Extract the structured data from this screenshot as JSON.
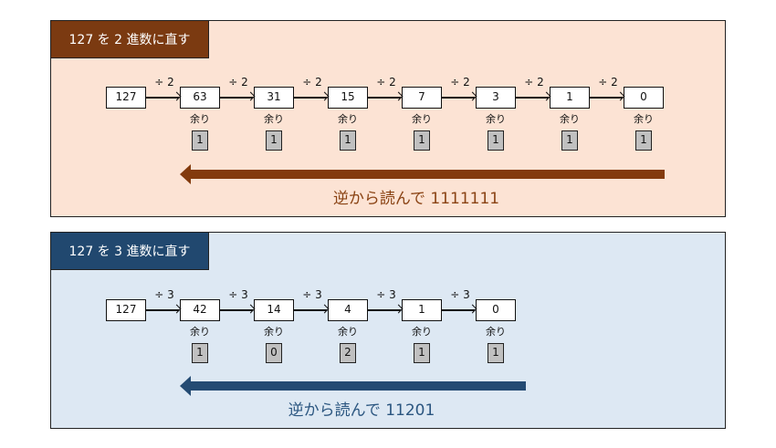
{
  "colors": {
    "brown_header": "#7b3a11",
    "brown_bg": "#fce3d4",
    "brown_arrow": "#833a0d",
    "brown_text": "#8a4314",
    "blue_header": "#21486f",
    "blue_bg": "#dde8f3",
    "blue_arrow": "#244b73",
    "blue_text": "#2b5680"
  },
  "base2": {
    "title": "127 を 2 進数に直す",
    "operator": "÷ 2",
    "quotients": [
      "127",
      "63",
      "31",
      "15",
      "7",
      "3",
      "1",
      "0"
    ],
    "remainder_label": "余り",
    "remainders": [
      "1",
      "1",
      "1",
      "1",
      "1",
      "1",
      "1"
    ],
    "result_text": "逆から読んで 1111111"
  },
  "base3": {
    "title": "127 を 3 進数に直す",
    "operator": "÷ 3",
    "quotients": [
      "127",
      "42",
      "14",
      "4",
      "1",
      "0"
    ],
    "remainder_label": "余り",
    "remainders": [
      "1",
      "0",
      "2",
      "1",
      "1"
    ],
    "result_text": "逆から読んで 11201"
  }
}
